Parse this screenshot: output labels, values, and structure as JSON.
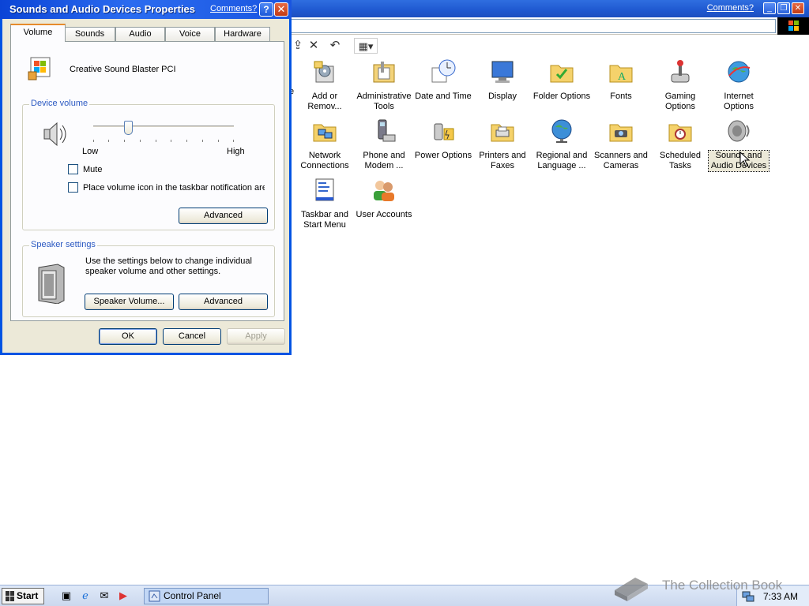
{
  "control_panel": {
    "comments_link": "Comments?",
    "icons": [
      {
        "label": "Add or Remov...",
        "icon": "add-remove-programs-icon"
      },
      {
        "label": "Administrative Tools",
        "icon": "administrative-tools-icon"
      },
      {
        "label": "Date and Time",
        "icon": "date-time-icon"
      },
      {
        "label": "Display",
        "icon": "display-icon"
      },
      {
        "label": "Folder Options",
        "icon": "folder-options-icon"
      },
      {
        "label": "Fonts",
        "icon": "fonts-icon"
      },
      {
        "label": "Gaming Options",
        "icon": "gaming-options-icon"
      },
      {
        "label": "Internet Options",
        "icon": "internet-options-icon"
      },
      {
        "label": "Network Connections",
        "icon": "network-connections-icon"
      },
      {
        "label": "Phone and Modem ...",
        "icon": "phone-modem-icon"
      },
      {
        "label": "Power Options",
        "icon": "power-options-icon"
      },
      {
        "label": "Printers and Faxes",
        "icon": "printers-faxes-icon"
      },
      {
        "label": "Regional and Language ...",
        "icon": "regional-language-icon"
      },
      {
        "label": "Scanners and Cameras",
        "icon": "scanners-cameras-icon"
      },
      {
        "label": "Scheduled Tasks",
        "icon": "scheduled-tasks-icon"
      },
      {
        "label": "Sounds and Audio Devices",
        "icon": "sounds-audio-icon"
      },
      {
        "label": "Taskbar and Start Menu",
        "icon": "taskbar-start-icon"
      },
      {
        "label": "User Accounts",
        "icon": "user-accounts-icon"
      }
    ],
    "partial_text": "e"
  },
  "dialog": {
    "title": "Sounds and Audio Devices Properties",
    "comments_link": "Comments?",
    "help_glyph": "?",
    "close_glyph": "✕",
    "tabs": [
      "Volume",
      "Sounds",
      "Audio",
      "Voice",
      "Hardware"
    ],
    "active_tab": "Volume",
    "device_name": "Creative Sound Blaster PCI",
    "device_volume": {
      "title": "Device volume",
      "low_label": "Low",
      "high_label": "High",
      "level": 0.25,
      "mute_label": "Mute",
      "mute_checked": false,
      "taskbar_icon_label": "Place volume icon in the taskbar notification area",
      "taskbar_icon_checked": false,
      "advanced_label": "Advanced"
    },
    "speaker_settings": {
      "title": "Speaker settings",
      "description": "Use the settings below to change individual speaker volume and other settings.",
      "speaker_volume_label": "Speaker Volume...",
      "advanced_label": "Advanced"
    },
    "ok_label": "OK",
    "cancel_label": "Cancel",
    "apply_label": "Apply"
  },
  "taskbar": {
    "start_label": "Start",
    "task_label": "Control Panel",
    "clock": "7:33 AM"
  },
  "watermark": "The Collection Book",
  "colors": {
    "title_blue": "#2b6cf0",
    "dialog_face": "#ece9d8",
    "group_title": "#2b59c2"
  }
}
